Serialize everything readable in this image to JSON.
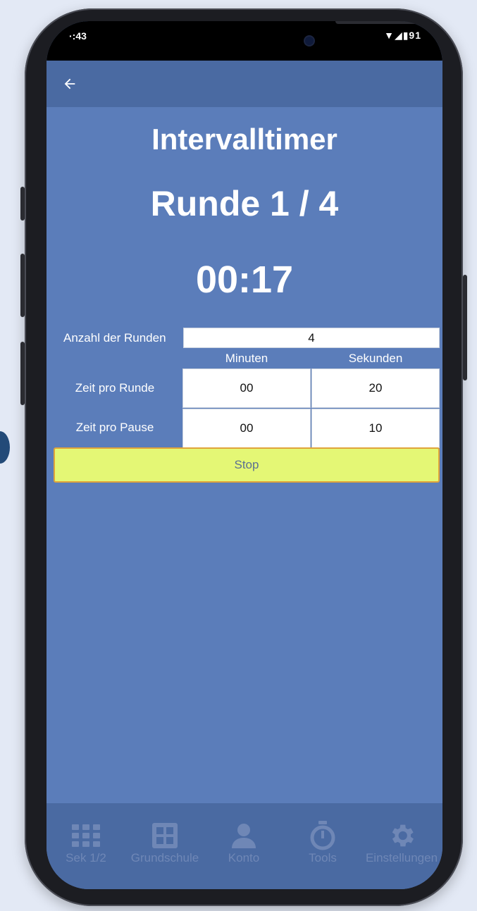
{
  "status": {
    "time": "·:43",
    "icons": "▼◢▮91"
  },
  "header": {
    "back_icon": "arrow-left-icon"
  },
  "timer": {
    "title": "Intervalltimer",
    "round": "Runde 1 / 4",
    "countdown": "00:17"
  },
  "form": {
    "rounds_label": "Anzahl der Runden",
    "rounds_value": "4",
    "col_minutes": "Minuten",
    "col_seconds": "Sekunden",
    "work_label": "Zeit pro Runde",
    "work_minutes": "00",
    "work_seconds": "20",
    "pause_label": "Zeit pro Pause",
    "pause_minutes": "00",
    "pause_seconds": "10"
  },
  "actions": {
    "stop_label": "Stop"
  },
  "nav": {
    "items": [
      {
        "label": "Sek 1/2",
        "icon": "grid-icon"
      },
      {
        "label": "Grundschule",
        "icon": "table-icon"
      },
      {
        "label": "Konto",
        "icon": "person-icon"
      },
      {
        "label": "Tools",
        "icon": "stopwatch-icon"
      },
      {
        "label": "Einstellungen",
        "icon": "gear-icon"
      }
    ]
  },
  "colors": {
    "background": "#5b7dba",
    "bar": "#4a6aa2",
    "stop": "#e4f775",
    "nav_inactive": "#6f87b6"
  }
}
